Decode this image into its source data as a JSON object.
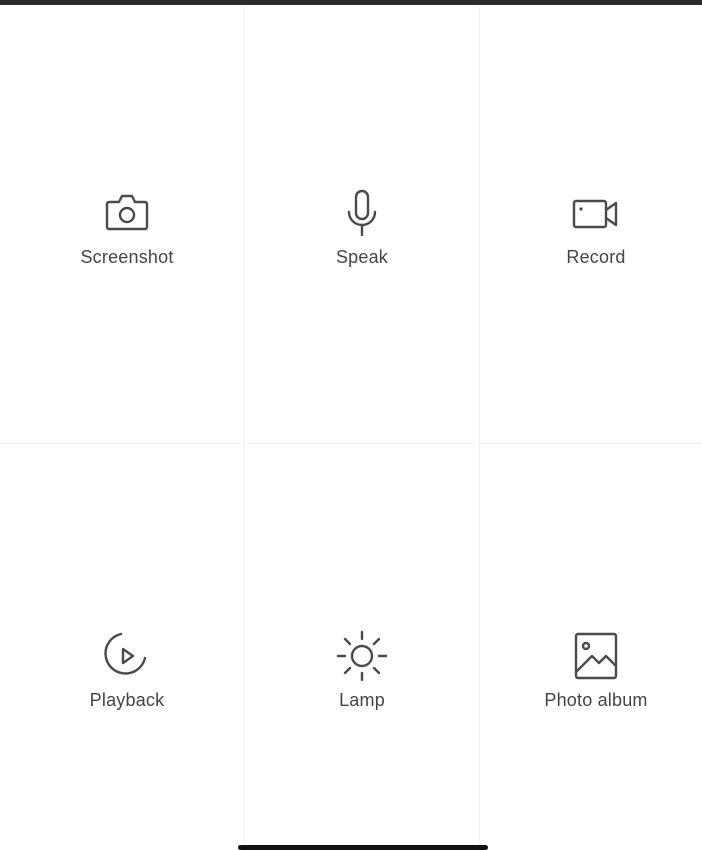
{
  "actions": [
    {
      "label": "Screenshot",
      "icon": "camera-icon"
    },
    {
      "label": "Speak",
      "icon": "microphone-icon"
    },
    {
      "label": "Record",
      "icon": "video-camera-icon"
    },
    {
      "label": "Playback",
      "icon": "playback-icon"
    },
    {
      "label": "Lamp",
      "icon": "sun-icon"
    },
    {
      "label": "Photo album",
      "icon": "image-icon"
    }
  ],
  "colors": {
    "icon_stroke": "#4a4a4a",
    "label_text": "#444444",
    "divider": "#f1f1f1",
    "background": "#ffffff"
  }
}
